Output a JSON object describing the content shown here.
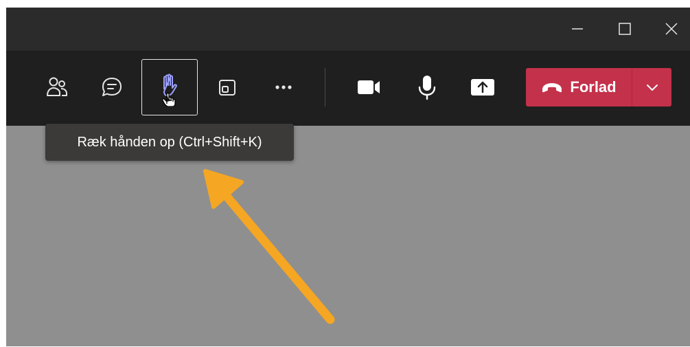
{
  "window": {
    "minimize_icon": "minimize-icon",
    "maximize_icon": "maximize-icon",
    "close_icon": "close-icon"
  },
  "toolbar": {
    "buttons": [
      {
        "name": "participants",
        "icon": "people-icon"
      },
      {
        "name": "chat",
        "icon": "chat-icon"
      },
      {
        "name": "raise-hand",
        "icon": "hand-icon",
        "focused": true
      },
      {
        "name": "rooms",
        "icon": "breakout-rooms-icon"
      },
      {
        "name": "more",
        "icon": "more-icon"
      },
      {
        "name": "camera",
        "icon": "camera-icon"
      },
      {
        "name": "mic",
        "icon": "microphone-icon"
      },
      {
        "name": "share",
        "icon": "share-screen-icon"
      }
    ],
    "leave_label": "Forlad",
    "leave_color": "#c4314b"
  },
  "tooltip": {
    "text": "Ræk hånden op (Ctrl+Shift+K)"
  },
  "colors": {
    "stage": "#8f8f8f",
    "toolbar": "#1f1f1f",
    "titlebar": "#2b2b2b",
    "hand_icon": "#9ea2ff",
    "annotation_arrow": "#f5a623"
  }
}
